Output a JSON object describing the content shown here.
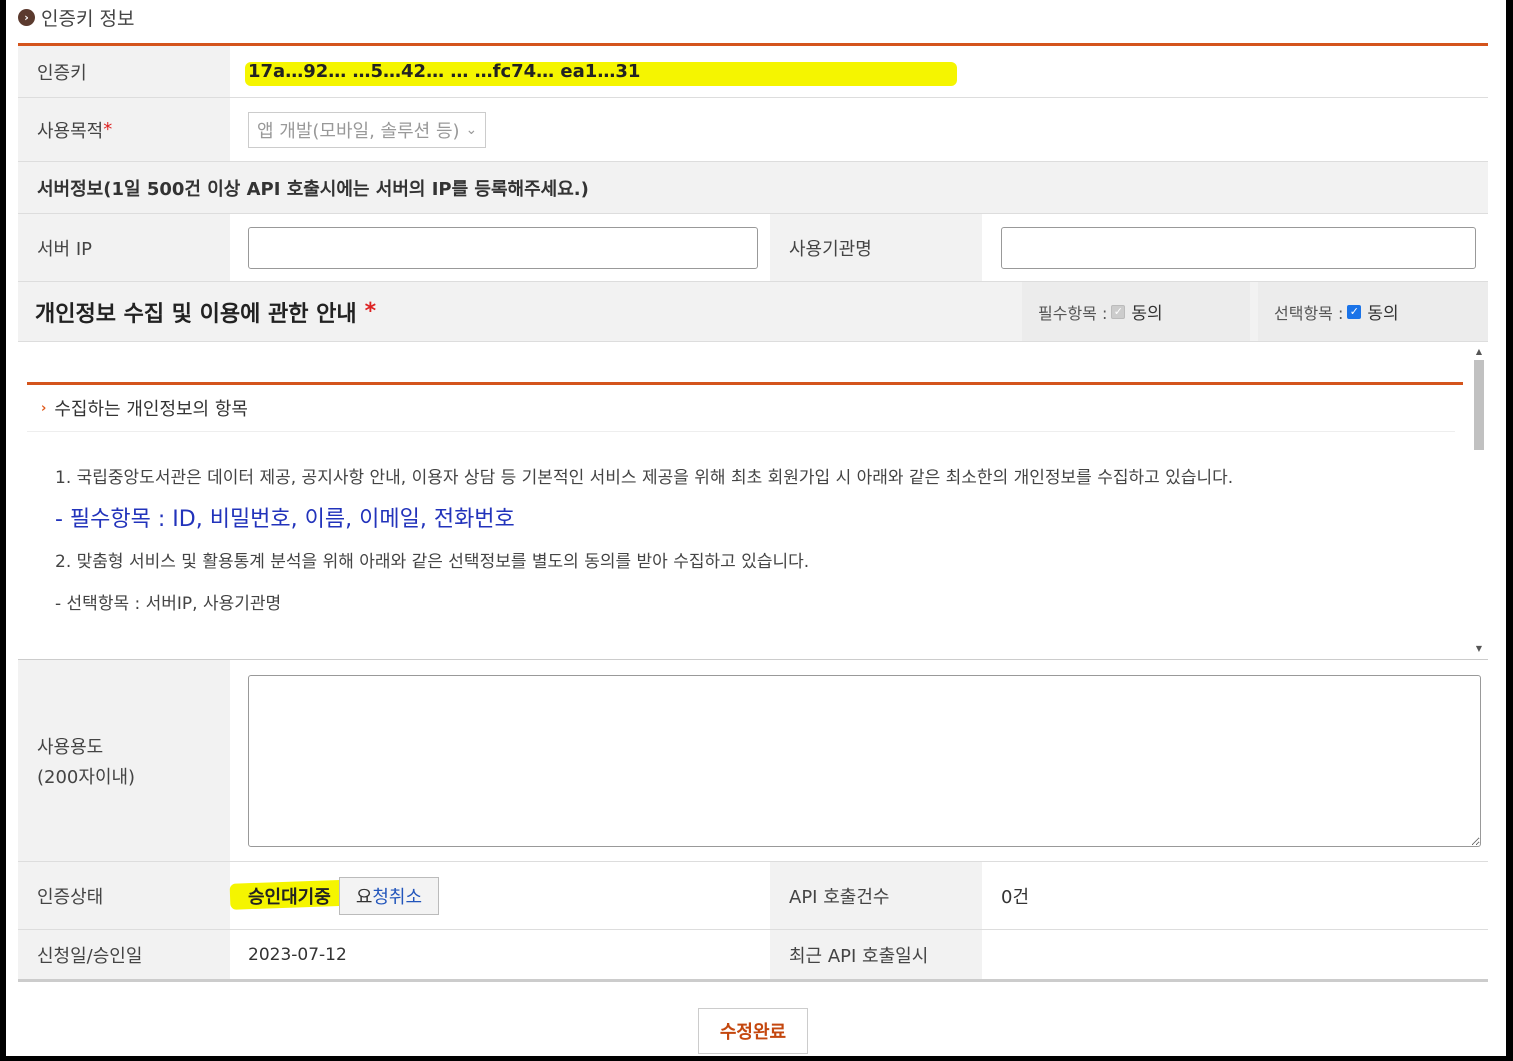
{
  "section": {
    "title": "인증키 정보"
  },
  "auth_key": {
    "label": "인증키",
    "value": "17a…92…  …5…42…  …  …fc74… ea1…31"
  },
  "purpose": {
    "label": "사용목적",
    "required_mark": "*",
    "selected": "앱 개발(모바일, 솔루션 등)"
  },
  "server_info": {
    "heading": "서버정보(1일 500건 이상 API 호출시에는 서버의 IP를 등록해주세요.)",
    "ip_label": "서버 IP",
    "ip_value": "",
    "org_label": "사용기관명",
    "org_value": ""
  },
  "privacy": {
    "title": "개인정보 수집 및 이용에 관한 안내",
    "required_mark": "*",
    "required_agree_label": "필수항목 :",
    "required_agree_word": "동의",
    "optional_agree_label": "선택항목 :",
    "optional_agree_word": "동의",
    "subheading": "수집하는 개인정보의 항목",
    "lines": [
      "1. 국립중앙도서관은 데이터 제공, 공지사항 안내, 이용자 상담 등 기본적인 서비스 제공을 위해 최초 회원가입 시 아래와 같은 최소한의 개인정보를 수집하고 있습니다.",
      "- 필수항목 : ID, 비밀번호, 이름, 이메일, 전화번호",
      "2. 맞춤형 서비스 및 활용통계 분석을 위해 아래와 같은 선택정보를 별도의 동의를 받아 수집하고 있습니다.",
      "- 선택항목 : 서버IP, 사용기관명"
    ]
  },
  "usage": {
    "label_line1": "사용용도",
    "label_line2": "(200자이내)",
    "value": ""
  },
  "status": {
    "label": "인증상태",
    "value": "승인대기중",
    "cancel_first": "요",
    "cancel_rest": "청취소",
    "api_count_label": "API 호출건수",
    "api_count_value": "0건"
  },
  "dates": {
    "label": "신청일/승인일",
    "value": "2023-07-12",
    "recent_call_label": "최근 API 호출일시",
    "recent_call_value": ""
  },
  "actions": {
    "save_label": "수정완료"
  },
  "colors": {
    "accent": "#d4541c",
    "highlight": "#f5f500",
    "link_blue": "#2233bb"
  }
}
